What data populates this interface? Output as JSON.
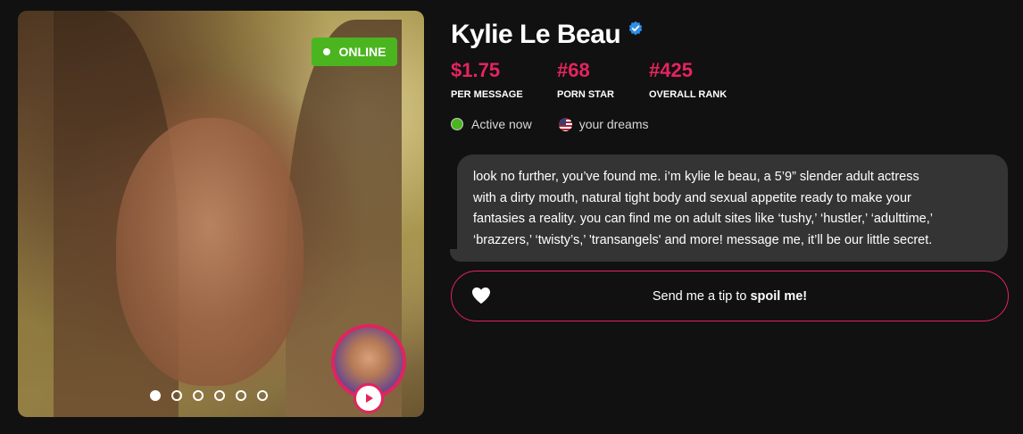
{
  "profile": {
    "name": "Kylie Le Beau",
    "online_badge": "ONLINE",
    "status": "Active now",
    "location": "your dreams"
  },
  "stats": [
    {
      "value": "$1.75",
      "label": "PER MESSAGE"
    },
    {
      "value": "#68",
      "label": "PORN STAR"
    },
    {
      "value": "#425",
      "label": "OVERALL RANK"
    }
  ],
  "bio": {
    "lines": [
      "look no further, you’ve found me. i’m kylie le beau, a 5’9” slender adult actress",
      "with a dirty mouth, natural tight body and sexual appetite ready to make your",
      "fantasies a reality. you can find me on adult sites like ‘tushy,’ ‘hustler,’ ‘adulttime,’",
      "‘brazzers,’ ‘twisty’s,’ 'transangels' and more! message me, it’ll be our little secret."
    ]
  },
  "tip_button": {
    "prefix": "Send me a tip to",
    "emphasis": "spoil me!"
  },
  "gallery": {
    "slide_count": 6,
    "active_index": 0
  },
  "icons": {
    "verified": "verified-badge-icon",
    "heart": "heart-icon",
    "play": "play-icon",
    "flag": "us-flag-icon"
  },
  "colors": {
    "accent": "#e5245f",
    "online": "#4bb51f",
    "verified": "#2f8fe8",
    "bubble": "#343434",
    "background": "#111111"
  }
}
